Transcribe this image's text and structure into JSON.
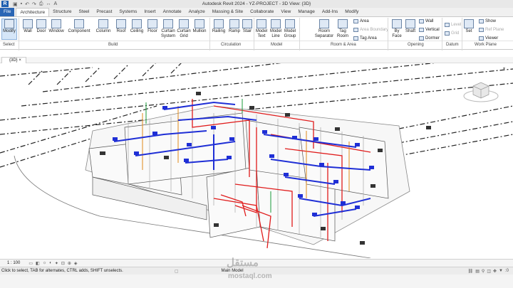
{
  "app": {
    "title": "Autodesk Revit 2024 - YZ-PROJECT - 3D View: {3D}",
    "logo": "R"
  },
  "qat_icons": [
    "open-icon",
    "save-icon",
    "undo-icon",
    "redo-icon",
    "print-icon",
    "measure-icon",
    "text-icon"
  ],
  "tabs": [
    {
      "label": "File"
    },
    {
      "label": "Architecture"
    },
    {
      "label": "Structure"
    },
    {
      "label": "Steel"
    },
    {
      "label": "Precast"
    },
    {
      "label": "Systems"
    },
    {
      "label": "Insert"
    },
    {
      "label": "Annotate"
    },
    {
      "label": "Analyze"
    },
    {
      "label": "Massing & Site"
    },
    {
      "label": "Collaborate"
    },
    {
      "label": "View"
    },
    {
      "label": "Manage"
    },
    {
      "label": "Add-Ins"
    },
    {
      "label": "Modify"
    }
  ],
  "ribbon": {
    "modify": "Modify",
    "wall": "Wall",
    "door": "Door",
    "window": "Window",
    "component": "Component",
    "column": "Column",
    "roof": "Roof",
    "ceiling": "Ceiling",
    "floor": "Floor",
    "curtain_system_1": "Curtain",
    "curtain_system_2": "System",
    "curtain_grid_1": "Curtain",
    "curtain_grid_2": "Grid",
    "mullion": "Mullion",
    "railing": "Railing",
    "ramp": "Ramp",
    "stair": "Stair",
    "model_text_1": "Model",
    "model_text_2": "Text",
    "model_line_1": "Model",
    "model_line_2": "Line",
    "model_group_1": "Model",
    "model_group_2": "Group",
    "room_separator_1": "Room",
    "room_separator_2": "Separator",
    "tag_room_1": "Tag",
    "tag_room_2": "Room",
    "area": "Area",
    "area_boundary": "Area Boundary",
    "tag_area": "Tag Area",
    "by_face_1": "By",
    "by_face_2": "Face",
    "shaft": "Shaft",
    "wall_opening": "Wall",
    "vertical": "Vertical",
    "dormer": "Dormer",
    "level": "Level",
    "grid": "Grid",
    "set": "Set",
    "show": "Show",
    "ref_plane": "Ref Plane",
    "viewer": "Viewer"
  },
  "panels": {
    "select": "Select",
    "build": "Build",
    "circulation": "Circulation",
    "model": "Model",
    "room_area": "Room & Area",
    "opening": "Opening",
    "datum": "Datum",
    "work_plane": "Work Plane"
  },
  "view_tab": "{3D}",
  "status": {
    "scale": "1 : 100",
    "hint": "Click to select, TAB for alternates, CTRL adds, SHIFT unselects.",
    "model": "Main Model",
    "filter_count": ":0"
  },
  "watermark": {
    "arabic": "مستقل",
    "latin": "mostaql.com"
  },
  "colors": {
    "file_tab": "#2a66b5",
    "pipe_red": "#e01b1b",
    "duct_blue": "#1f2fd6",
    "pipe_orange": "#e08a1b",
    "pipe_green": "#1a9a3a"
  }
}
